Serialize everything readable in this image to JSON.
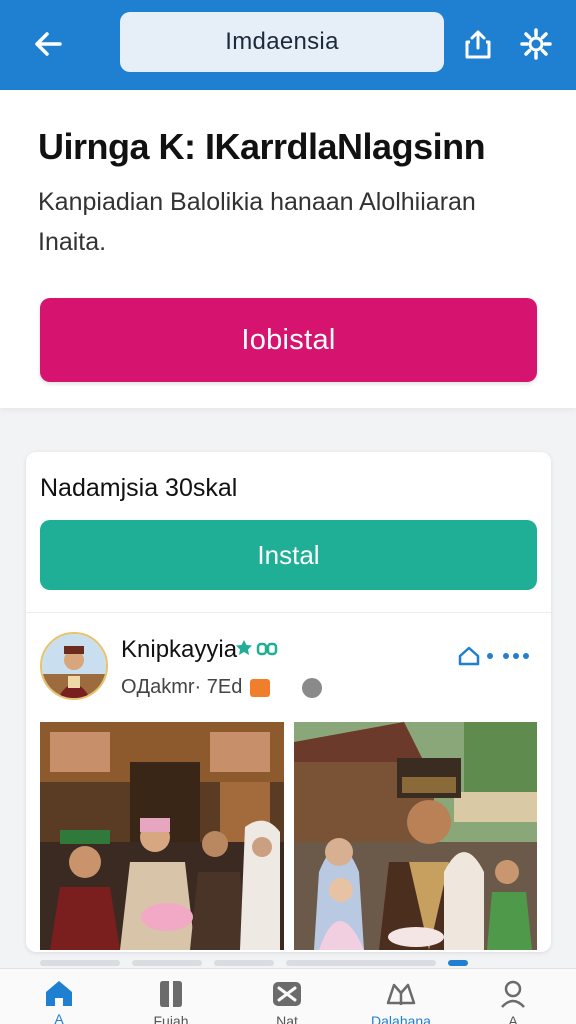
{
  "appbar": {
    "address_text": "Imdaensia",
    "back_icon": "arrow-left-icon",
    "share_icon": "share-icon",
    "settings_icon": "gear-icon",
    "color": "#1f7fd0"
  },
  "hero": {
    "title": "Uirnga K: IKarrdlaNlagsinn",
    "description": "Kanpiadian Balolikia hanaan Alolhiiaran Inaita.",
    "cta_label": "Iobistal",
    "cta_color": "#d6146f"
  },
  "card": {
    "title": "Nadamjsia 30skal",
    "install_label": "Instal",
    "install_color": "#1fae96"
  },
  "post": {
    "author": "Knipkayyia",
    "meta_text": "OДakmr· 7Εd",
    "avatar_icon": "avatar-icon"
  },
  "bottom_nav": [
    {
      "icon": "home-icon",
      "label": "A"
    },
    {
      "icon": "book-icon",
      "label": "Fujah"
    },
    {
      "icon": "mail-icon",
      "label": "Nat"
    },
    {
      "icon": "hands-book-icon",
      "label": "Dalahana"
    },
    {
      "icon": "profile-icon",
      "label": "A"
    }
  ]
}
